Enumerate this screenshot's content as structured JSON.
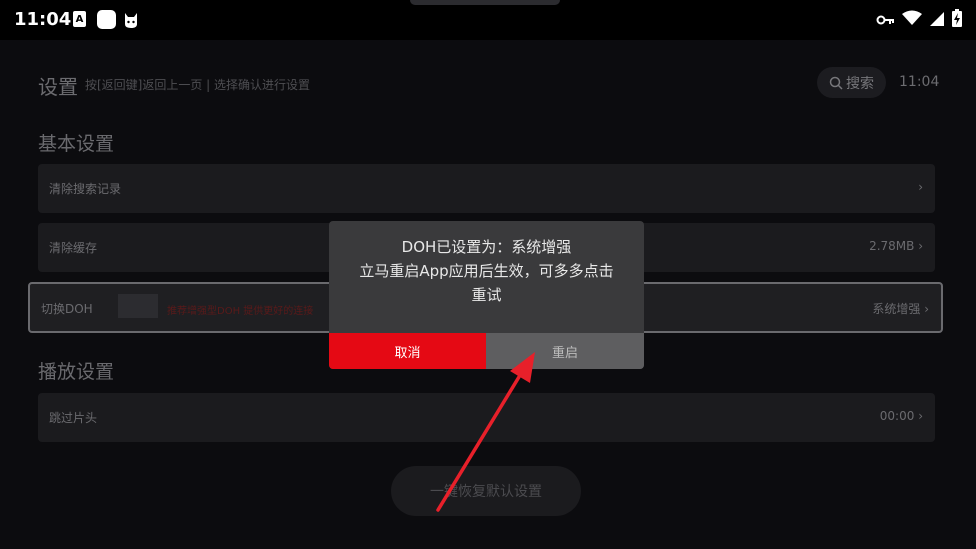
{
  "status_bar": {
    "time": "11:04",
    "icons": [
      "a-badge-icon",
      "square-app-icon",
      "cat-icon",
      "vpn-key-icon",
      "wifi-icon",
      "cell-signal-icon",
      "battery-charging-icon"
    ]
  },
  "header": {
    "title": "设置",
    "hint": "按[返回键]返回上一页 | 选择确认进行设置",
    "search_label": "搜索",
    "clock": "11:04"
  },
  "sections": {
    "basic": {
      "title": "基本设置",
      "items": [
        {
          "label": "清除搜索记录",
          "value": ""
        },
        {
          "label": "清除缓存",
          "value": "2.78MB"
        },
        {
          "label": "切换DOH",
          "value": "系统增强",
          "note": "推荐增强型DOH 提供更好的连接"
        }
      ]
    },
    "playback": {
      "title": "播放设置",
      "items": [
        {
          "label": "跳过片头",
          "value": "00:00"
        }
      ]
    }
  },
  "reset_button": "一键恢复默认设置",
  "dialog": {
    "line1": "DOH已设置为：系统增强",
    "line2": "立马重启App应用后生效，可多多点击",
    "line3": "重试",
    "cancel_label": "取消",
    "restart_label": "重启"
  },
  "colors": {
    "accent_red": "#e50914",
    "background": "#0c0c0f",
    "dialog_bg": "#3a3a3c"
  }
}
